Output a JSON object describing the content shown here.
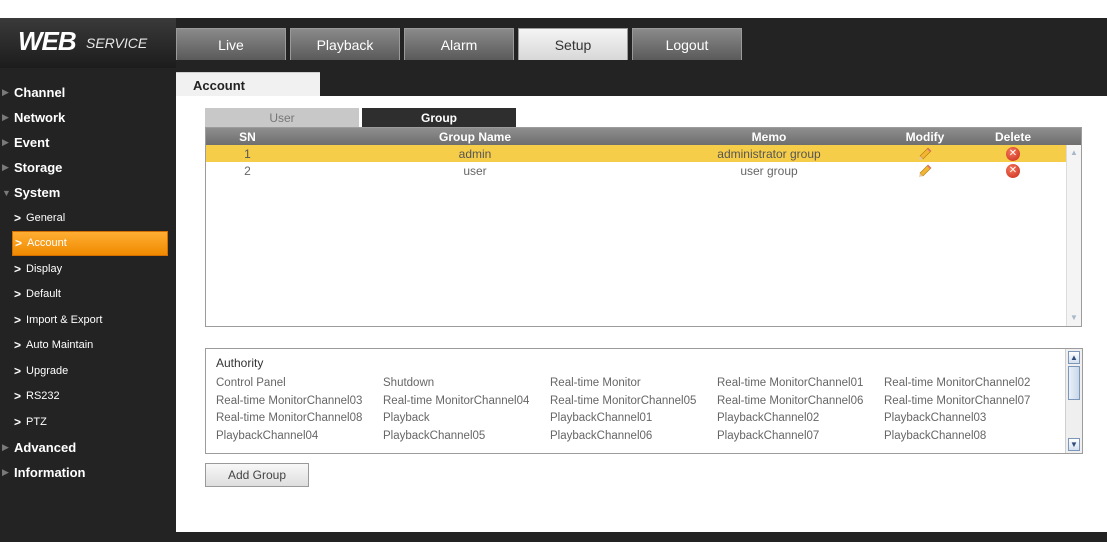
{
  "logo": {
    "web": "WEB",
    "service": "SERVICE"
  },
  "nav": {
    "tabs": [
      {
        "label": "Live"
      },
      {
        "label": "Playback"
      },
      {
        "label": "Alarm"
      },
      {
        "label": "Setup",
        "active": true
      },
      {
        "label": "Logout"
      }
    ]
  },
  "sidebar": {
    "groups": [
      {
        "label": "Channel"
      },
      {
        "label": "Network"
      },
      {
        "label": "Event"
      },
      {
        "label": "Storage"
      },
      {
        "label": "System",
        "expanded": true
      }
    ],
    "system_items": [
      {
        "label": "General"
      },
      {
        "label": "Account",
        "active": true
      },
      {
        "label": "Display"
      },
      {
        "label": "Default"
      },
      {
        "label": "Import & Export"
      },
      {
        "label": "Auto Maintain"
      },
      {
        "label": "Upgrade"
      },
      {
        "label": "RS232"
      },
      {
        "label": "PTZ"
      }
    ],
    "bottom_groups": [
      {
        "label": "Advanced"
      },
      {
        "label": "Information"
      }
    ]
  },
  "page": {
    "tab_label": "Account",
    "subtabs": {
      "user": "User",
      "group": "Group",
      "active": "group"
    }
  },
  "group_table": {
    "columns": {
      "sn": "SN",
      "group_name": "Group Name",
      "memo": "Memo",
      "modify": "Modify",
      "delete": "Delete"
    },
    "rows": [
      {
        "sn": "1",
        "group_name": "admin",
        "memo": "administrator group",
        "selected": true
      },
      {
        "sn": "2",
        "group_name": "user",
        "memo": "user group",
        "selected": false
      }
    ]
  },
  "authority": {
    "title": "Authority",
    "permissions": [
      "Control Panel",
      "Shutdown",
      "Real-time Monitor",
      "Real-time MonitorChannel01",
      "Real-time MonitorChannel02",
      "Real-time MonitorChannel03",
      "Real-time MonitorChannel04",
      "Real-time MonitorChannel05",
      "Real-time MonitorChannel06",
      "Real-time MonitorChannel07",
      "Real-time MonitorChannel08",
      "Playback",
      "PlaybackChannel01",
      "PlaybackChannel02",
      "PlaybackChannel03",
      "PlaybackChannel04",
      "PlaybackChannel05",
      "PlaybackChannel06",
      "PlaybackChannel07",
      "PlaybackChannel08"
    ]
  },
  "actions": {
    "add_group": "Add Group"
  },
  "icons": {
    "modify": "pencil-icon",
    "delete": "delete-x-icon",
    "scroll_up": "chevron-up-icon",
    "scroll_down": "chevron-down-icon"
  },
  "colors": {
    "frame_bg": "#232323",
    "accent_orange": "#f59a12",
    "selected_row": "#f6cd49",
    "table_header": "#7e7e7e",
    "active_subtab": "#2e2e2e",
    "delete_red": "#d9361f"
  }
}
